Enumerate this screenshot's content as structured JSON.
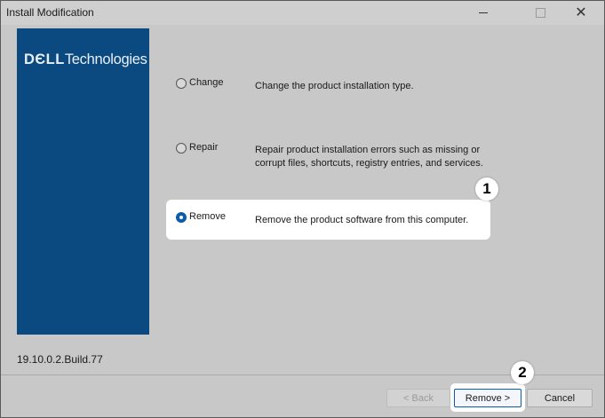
{
  "window": {
    "title": "Install Modification",
    "controls": {
      "minimize": "—",
      "maximize": "☐",
      "close": "✕"
    }
  },
  "banner": {
    "logo_brand": "DЄLL",
    "logo_suffix": "Technologies"
  },
  "options": [
    {
      "label": "Change",
      "description": "Change the product installation type.",
      "selected": false
    },
    {
      "label": "Repair",
      "description": "Repair product installation errors such as missing or corrupt files, shortcuts, registry entries, and services.",
      "selected": false
    },
    {
      "label": "Remove",
      "description": "Remove the product software from this computer.",
      "selected": true
    }
  ],
  "version": "19.10.0.2.Build.77",
  "buttons": {
    "back": "< Back",
    "remove": "Remove >",
    "cancel": "Cancel"
  },
  "annotations": {
    "step1": "1",
    "step2": "2"
  },
  "colors": {
    "banner": "#0b4a80",
    "accent": "#0b5cad"
  }
}
